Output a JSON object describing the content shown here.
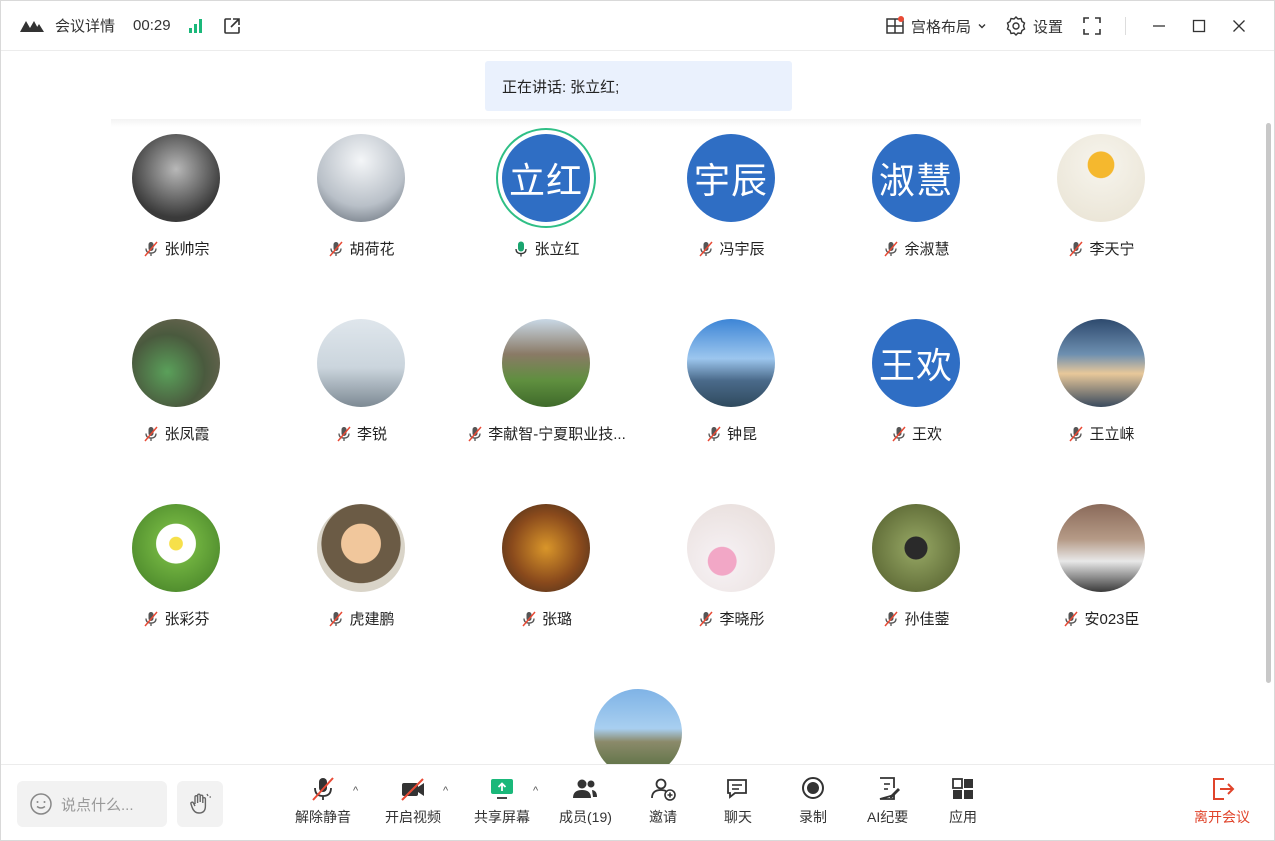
{
  "titlebar": {
    "meeting_info": "会议详情",
    "timer": "00:29",
    "layout_label": "宫格布局",
    "settings_label": "设置"
  },
  "speaking_banner": {
    "label": "正在讲话:",
    "speaker": "张立红;"
  },
  "participants": [
    {
      "name": "张帅宗",
      "avatar_text": "",
      "muted": true
    },
    {
      "name": "胡荷花",
      "avatar_text": "",
      "muted": true
    },
    {
      "name": "张立红",
      "avatar_text": "立红",
      "muted": false,
      "speaking": true
    },
    {
      "name": "冯宇辰",
      "avatar_text": "宇辰",
      "muted": true
    },
    {
      "name": "余淑慧",
      "avatar_text": "淑慧",
      "muted": true
    },
    {
      "name": "李天宁",
      "avatar_text": "",
      "muted": true
    },
    {
      "name": "张凤霞",
      "avatar_text": "",
      "muted": true
    },
    {
      "name": "李锐",
      "avatar_text": "",
      "muted": true
    },
    {
      "name": "李献智-宁夏职业技...",
      "avatar_text": "",
      "muted": true
    },
    {
      "name": "钟昆",
      "avatar_text": "",
      "muted": true
    },
    {
      "name": "王欢",
      "avatar_text": "王欢",
      "muted": true
    },
    {
      "name": "王立崃",
      "avatar_text": "",
      "muted": true
    },
    {
      "name": "张彩芬",
      "avatar_text": "",
      "muted": true
    },
    {
      "name": "虎建鹏",
      "avatar_text": "",
      "muted": true
    },
    {
      "name": "张璐",
      "avatar_text": "",
      "muted": true
    },
    {
      "name": "李晓彤",
      "avatar_text": "",
      "muted": true
    },
    {
      "name": "孙佳蓥",
      "avatar_text": "",
      "muted": true
    },
    {
      "name": "安023臣",
      "avatar_text": "",
      "muted": true
    }
  ],
  "toolbar": {
    "chat_placeholder": "说点什么...",
    "unmute": "解除静音",
    "start_video": "开启视频",
    "share_screen": "共享屏幕",
    "members": "成员(19)",
    "invite": "邀请",
    "chat": "聊天",
    "record": "录制",
    "ai_minutes": "AI纪要",
    "apps": "应用",
    "leave": "离开会议"
  },
  "colors": {
    "accent_blue": "#2f6ec4",
    "speaking_green": "#2fbf86",
    "leave_red": "#e0442b",
    "banner_bg": "#eaf1fd"
  }
}
